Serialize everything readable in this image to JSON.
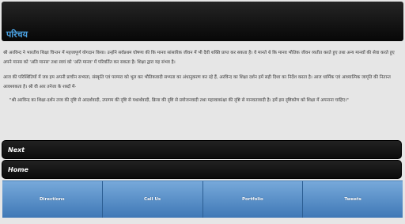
{
  "header": {
    "title": "परिचय"
  },
  "content": {
    "paragraph1": "श्री अरविन्द ने भारतीय शिक्षा चिन्तन में महत्त्वपूर्ण योगदान किया। उन्होंने सर्वप्रथम घोषणा की कि मानव सांसारिक जीवन में भी दैवी शक्ति प्राप्त कर सकता है। वे मानते थे कि मानव भौतिक जीवन व्यतीत करते हुए तथा अन्य मानवों की सेवा करते हुए अपने मानस को 'अति मानस' तथा स्वयं को 'अति मानव' में परिवर्तित कर सकता है। शिक्षा द्वारा यह संभव है।",
    "paragraph2": "आज की परिस्थितियों में जब हम अपनी प्राचीन सभ्यता, संस्कृति एवं परम्परा को भूल कर भौतिकवादी सभ्यता का अंधानुकरण कर रहे हैं, अरविन्द का शिक्षा दर्शन हमें सही दिशा का निर्देश करता है। आज धार्मिक एवं आध्यात्मिक जागृति की नितान्त आवश्यकता है। श्री वी आर तनेजा के शब्दों में-",
    "quote": "\"श्री अरविन्द का शिक्षा-दर्शन तत्त्व की दृष्टि से आदर्शवादी, उपागम की दृष्टि से यथार्थवादी, क्रिया की दृष्टि से प्रयोजनवादी तथा महत्त्वाकांक्षा की दृष्टि से मानवतावादी है। हमें इस दृष्टिकोण को शिक्षा में अपनाना चाहिए।\""
  },
  "nav": {
    "next_label": "Next",
    "home_label": "Home"
  },
  "tabs": [
    {
      "label": "Directions"
    },
    {
      "label": "Call Us"
    },
    {
      "label": "Portfolio"
    },
    {
      "label": "Tweets"
    }
  ],
  "colors": {
    "accent": "#4aa0e0",
    "tab_blue": "#5b8fc7",
    "bar_dark": "#111111"
  }
}
